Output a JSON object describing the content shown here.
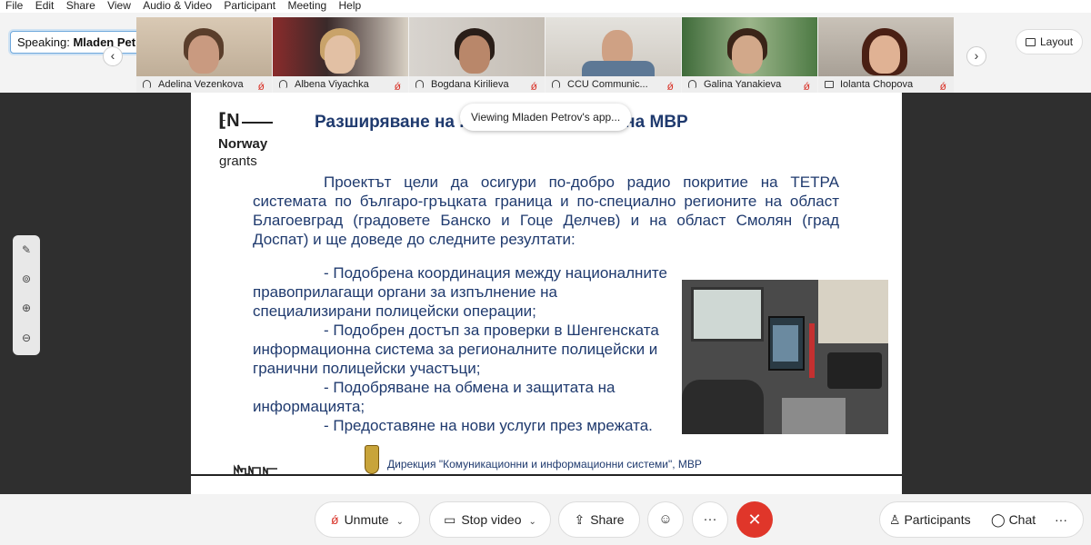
{
  "menu": [
    "File",
    "Edit",
    "Share",
    "View",
    "Audio & Video",
    "Participant",
    "Meeting",
    "Help"
  ],
  "speaking": {
    "prefix": "Speaking:",
    "name": "Mladen Petrov"
  },
  "layout_label": "Layout",
  "participants": [
    {
      "name": "Adelina Vezenkova",
      "icon": "headset-icon",
      "muted": true
    },
    {
      "name": "Albena Viyachka",
      "icon": "headset-icon",
      "muted": true
    },
    {
      "name": "Bogdana Kirilieva",
      "icon": "headset-icon",
      "muted": true
    },
    {
      "name": "CCU Communic...",
      "icon": "headset-icon",
      "muted": true
    },
    {
      "name": "Galina Yanakieva",
      "icon": "headset-icon",
      "muted": true
    },
    {
      "name": "Iolanta Chopova",
      "icon": "camera-icon",
      "muted": true
    }
  ],
  "tooltip": "Viewing Mladen Petrov's app...",
  "slide": {
    "logo_top": "Norway",
    "logo_bottom": "grants",
    "title": "Разширяване на ... инфраструктура на МВР",
    "paragraph": "Проектът цели да осигури по-добро радио покритие на ТЕТРА системата по българо-гръцката граница и по-специално регионите на област Благоевград (градовете Банско и Гоце Делчев) и на област Смолян (град Доспат) и ще доведе до следните резултати:",
    "bullets": [
      "- Подобрена координация между националните правоприлагащи органи за изпълнение на специализирани полицейски операции;",
      "- Подобрен достъп за проверки в Шенгенската информационна система за регионалните полицейски и гранични полицейски участъци;",
      "- Подобряване на обмена и защитата на информацията;",
      "- Предоставяне на нови услуги през мрежата."
    ],
    "footer": "Дирекция \"Комуникационни и информационни системи\", МВР"
  },
  "toolbar": {
    "unmute": "Unmute",
    "stop_video": "Stop video",
    "share": "Share",
    "participants": "Participants",
    "chat": "Chat",
    "more": "···"
  },
  "colors": {
    "accent_blue": "#1f3a6e",
    "end_red": "#e0362a",
    "muted_red": "#d9352b"
  }
}
